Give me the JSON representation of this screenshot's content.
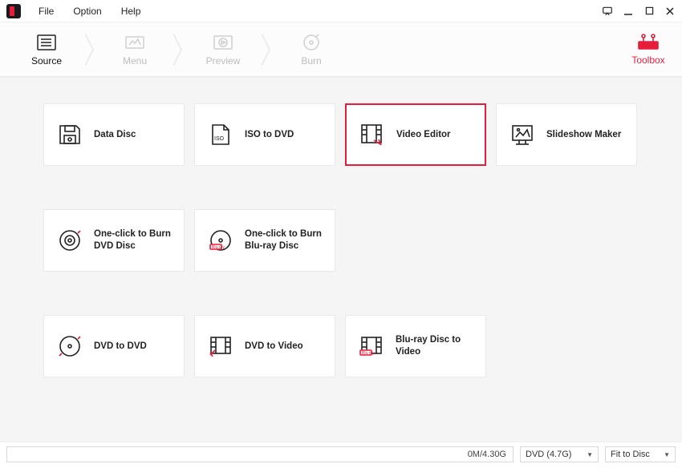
{
  "menu": {
    "file": "File",
    "option": "Option",
    "help": "Help"
  },
  "steps": {
    "source": "Source",
    "menu": "Menu",
    "preview": "Preview",
    "burn": "Burn",
    "toolbox": "Toolbox"
  },
  "cards": {
    "data_disc": "Data Disc",
    "iso_dvd": "ISO to DVD",
    "video_editor": "Video Editor",
    "slideshow": "Slideshow Maker",
    "oneclick_dvd": "One-click to Burn DVD Disc",
    "oneclick_bluray": "One-click to Burn Blu-ray Disc",
    "dvd_dvd": "DVD to DVD",
    "dvd_video": "DVD to Video",
    "bluray_video": "Blu-ray Disc to Video"
  },
  "bottom": {
    "progress": "0M/4.30G",
    "disc_type": "DVD (4.7G)",
    "fit": "Fit to Disc"
  }
}
